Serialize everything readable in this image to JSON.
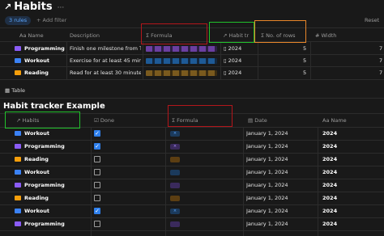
{
  "page": {
    "title": "Habits",
    "menu": "···"
  },
  "filters": {
    "rules": "3 rules",
    "add_filter": "+ Add filter",
    "reset": "Reset"
  },
  "top_table": {
    "headers": {
      "name": "Aa Name",
      "description": "Description",
      "formula": "Σ Formula",
      "habit_tracker": "↗ Habit tr",
      "rows": "Σ No. of rows",
      "width": "# Width"
    },
    "rows": [
      {
        "name": "Programming",
        "description": "Finish one milestone from THE",
        "habit": "2024",
        "rows": "5",
        "width": "7"
      },
      {
        "name": "Workout",
        "description": "Exercise for at least 45 minutes.",
        "habit": "2024",
        "rows": "5",
        "width": "7"
      },
      {
        "name": "Reading",
        "description": "Read for at least 30 minutes.",
        "habit": "2024",
        "rows": "5",
        "width": "7"
      }
    ]
  },
  "view": {
    "tab": "Table",
    "subtitle": "Habit tracker Example"
  },
  "bottom_table": {
    "headers": {
      "habits": "↗ Habits",
      "done": "Done",
      "formula": "Σ Formula",
      "date": "Date",
      "name": "Aa Name"
    },
    "rows": [
      {
        "habit": "Workout",
        "done": true,
        "date": "January 1, 2024",
        "name": "2024"
      },
      {
        "habit": "Programming",
        "done": true,
        "date": "January 1, 2024",
        "name": "2024"
      },
      {
        "habit": "Reading",
        "done": false,
        "date": "January 1, 2024",
        "name": "2024"
      },
      {
        "habit": "Workout",
        "done": false,
        "date": "January 1, 2024",
        "name": "2024"
      },
      {
        "habit": "Programming",
        "done": false,
        "date": "January 1, 2024",
        "name": "2024"
      },
      {
        "habit": "Reading",
        "done": false,
        "date": "January 1, 2024",
        "name": "2024"
      },
      {
        "habit": "Workout",
        "done": true,
        "date": "January 1, 2024",
        "name": "2024"
      },
      {
        "habit": "Programming",
        "done": false,
        "date": "January 1, 2024",
        "name": "2024"
      }
    ]
  },
  "colors": {
    "workout": "#3b82f6",
    "programming": "#8b5cf6",
    "reading": "#f59e0b",
    "accent": "#2f80ed"
  }
}
